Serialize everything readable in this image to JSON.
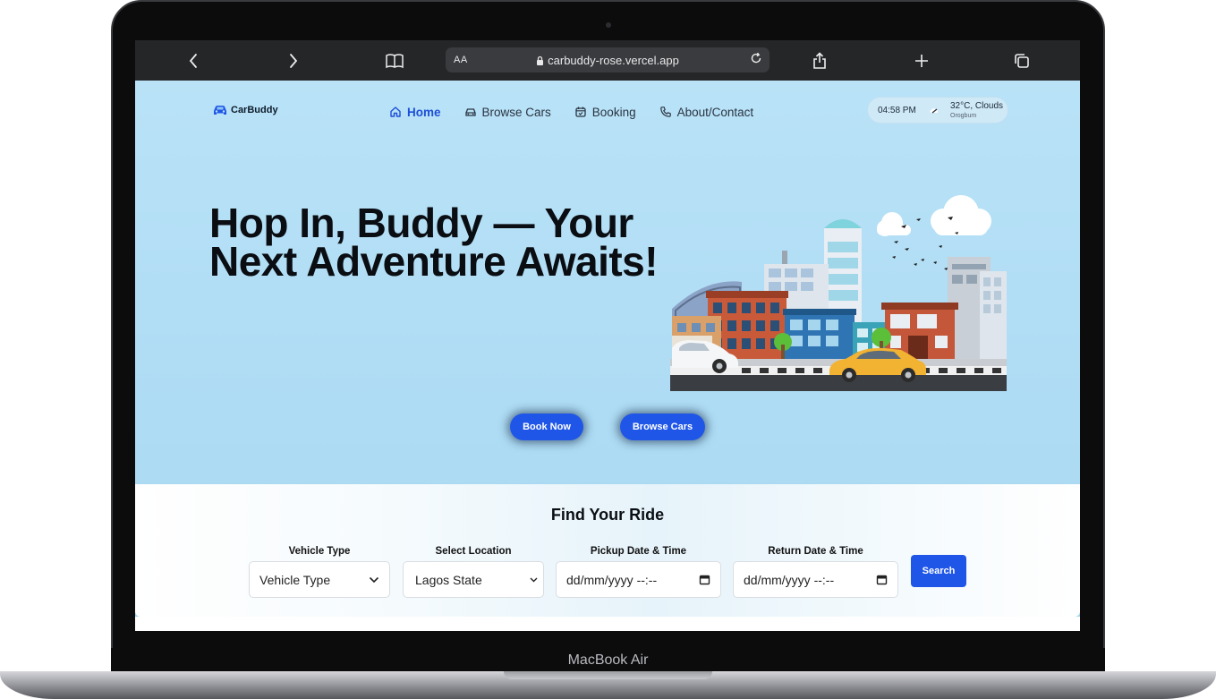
{
  "device": {
    "label": "MacBook Air"
  },
  "browser": {
    "reader_label": "AA",
    "url": "carbuddy-rose.vercel.app"
  },
  "brand": {
    "name": "CarBuddy",
    "accent": "#1f56e8"
  },
  "nav": {
    "items": [
      {
        "label": "Home",
        "icon": "home-icon",
        "active": true
      },
      {
        "label": "Browse Cars",
        "icon": "car-icon",
        "active": false
      },
      {
        "label": "Booking",
        "icon": "calendar-icon",
        "active": false
      },
      {
        "label": "About/Contact",
        "icon": "phone-icon",
        "active": false
      }
    ]
  },
  "widget": {
    "time": "04:58 PM",
    "temp": "32°C, Clouds",
    "city": "Orogbum"
  },
  "hero": {
    "title": "Hop In, Buddy — Your Next Adventure Awaits!",
    "book_label": "Book Now",
    "browse_label": "Browse Cars"
  },
  "search": {
    "title": "Find Your Ride",
    "fields": [
      {
        "label": "Vehicle Type",
        "value": "Vehicle Type"
      },
      {
        "label": "Select Location",
        "value": "Lagos State"
      },
      {
        "label": "Pickup Date & Time",
        "value": "dd/mm/yyyy --:--"
      },
      {
        "label": "Return Date & Time",
        "value": "dd/mm/yyyy --:--"
      }
    ],
    "button_label": "Search"
  }
}
